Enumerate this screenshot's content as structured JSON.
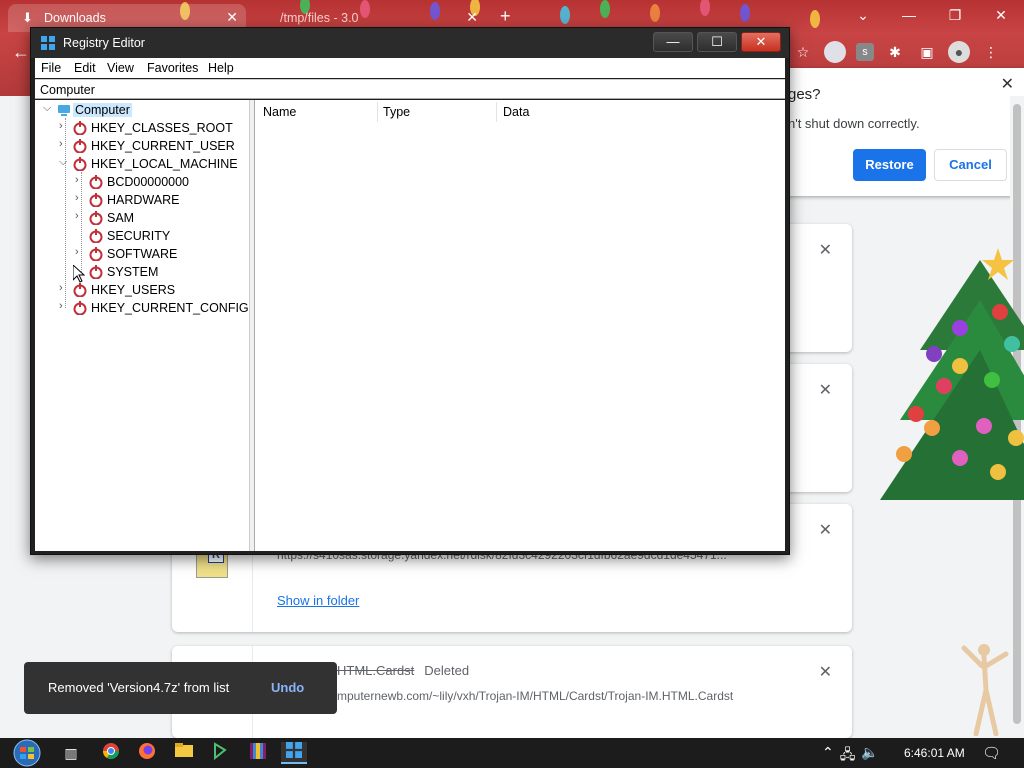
{
  "browser": {
    "tabs": [
      {
        "title": "Downloads",
        "icon": "download-icon"
      },
      {
        "title": "/tmp/files - 3.0",
        "icon": "file-icon"
      }
    ],
    "restore_popup": {
      "title": "ges?",
      "message": "n't shut down correctly.",
      "restore_label": "Restore",
      "cancel_label": "Cancel"
    },
    "downloads": [
      {
        "url": "https://s410sas.storage.yandex.net/rdisk/82fd3c4292203cf1dfb62ae9dcd1de45471...",
        "link": "Show in folder"
      },
      {
        "name_struck": "HTML.Cardst",
        "status": "Deleted",
        "url": "mputernewb.com/~lily/vxh/Trojan-IM/HTML/Cardst/Trojan-IM.HTML.Cardst"
      }
    ],
    "snackbar": {
      "message": "Removed 'Version4.7z' from list",
      "action": "Undo"
    }
  },
  "regedit": {
    "title": "Registry Editor",
    "menu": [
      "File",
      "Edit",
      "View",
      "Favorites",
      "Help"
    ],
    "address": "Computer",
    "columns": [
      "Name",
      "Type",
      "Data"
    ],
    "tree": {
      "root": "Computer",
      "hives": [
        "HKEY_CLASSES_ROOT",
        "HKEY_CURRENT_USER",
        "HKEY_LOCAL_MACHINE",
        "HKEY_USERS",
        "HKEY_CURRENT_CONFIG"
      ],
      "hklm_children": [
        "BCD00000000",
        "HARDWARE",
        "SAM",
        "SECURITY",
        "SOFTWARE",
        "SYSTEM"
      ]
    },
    "window_controls": {
      "minimize": "—",
      "maximize": "☐",
      "close": "✕"
    }
  },
  "taskbar": {
    "clock": "6:46:01 AM",
    "apps": [
      "task-view-icon",
      "chrome-icon",
      "firefox-icon",
      "file-explorer-icon",
      "network-tool-icon",
      "winrar-icon",
      "regedit-icon"
    ]
  },
  "colors": {
    "accent": "#1a73e8",
    "chrome_frame": "#b73232",
    "reg_selection": "#cce8ff"
  }
}
